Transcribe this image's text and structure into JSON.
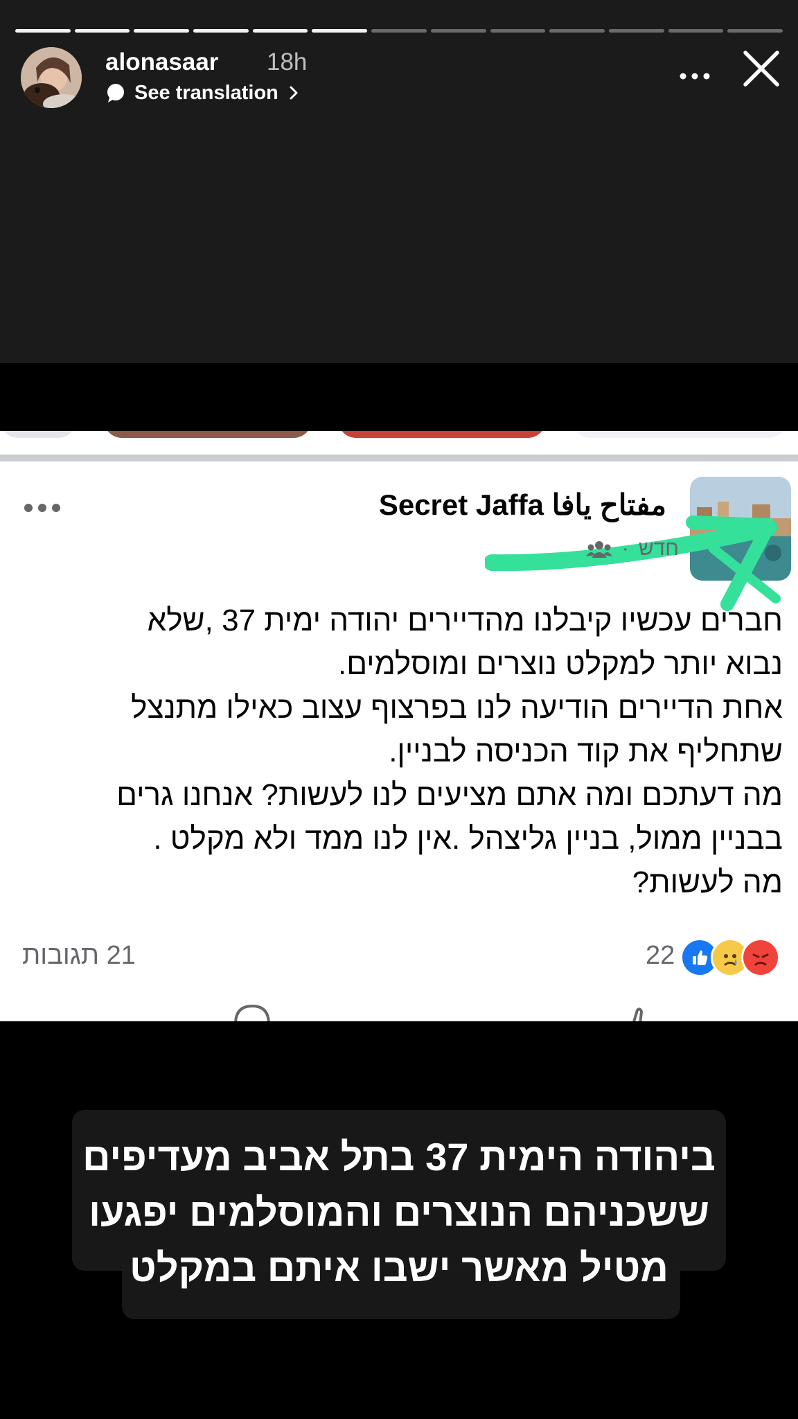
{
  "story": {
    "progress": {
      "total_segments": 13,
      "completed_segments": 6
    },
    "header": {
      "username": "alonasaar",
      "time": "18h",
      "see_translation": "See translation",
      "avatar_icon": "profile-photo"
    },
    "caption_text": "ביהודה הימית 37 בתל אביב מעדיפים\nששכניהם הנוצרים והמוסלמים יפגעו\nמטיל מאשר ישבו איתם במקלט"
  },
  "facebook_post": {
    "group_name": "Secret Jaffa مفتاح يافا",
    "meta_time": "חדש",
    "meta_icon": "people-icon",
    "body": "חברים עכשיו קיבלנו מהדיירים יהודה ימית 37 ,שלא\nנבוא יותר למקלט נוצרים ומוסלמים.\nאחת הדיירים הודיעה לנו בפרצוף עצוב כאילו מתנצל\nשתחליף את קוד הכניסה לבניין.\nמה דעתכם ומה אתם מציעים לנו לעשות? אנחנו גרים\nבבניין ממול, בניין גליצהל .אין לנו ממד ולא מקלט .\nמה לעשות?",
    "reactions_count": "22",
    "reaction_icons": [
      "like-icon",
      "sad-icon",
      "angry-icon"
    ],
    "comments_count": "21 תגובות"
  },
  "colors": {
    "story_bg": "#1b1b1b",
    "fb_text": "#050505",
    "fb_secondary": "#65676b",
    "highlight": "#35e09a",
    "like_blue": "#1877f2",
    "angry_red": "#f0433c",
    "sad_yellow": "#f7c948"
  }
}
